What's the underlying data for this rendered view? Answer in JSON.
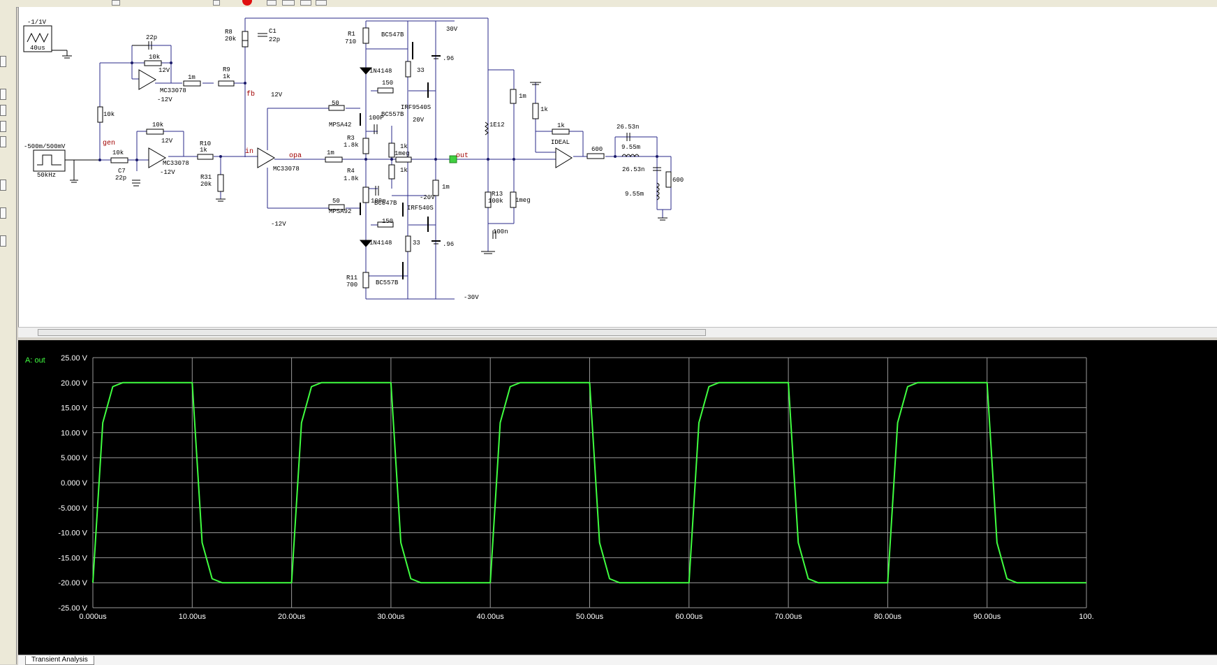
{
  "schematic": {
    "source1": {
      "label": "-1/1V",
      "period": "40us"
    },
    "source2": {
      "label": "-500m/500mV",
      "freq": "50kHz"
    },
    "components": {
      "c_22p_top": "22p",
      "r_10k_fb1": "10k",
      "r_1m_a": "1m",
      "r9_name": "R9",
      "r9_val": "1k",
      "r8_name": "R8",
      "r8_val": "20k",
      "c1_name": "C1",
      "c1_val": "22p",
      "r1_name": "R1",
      "r1_val": "710",
      "q_bc547b_top": "BC547B",
      "v_30": "30V",
      "batt_top": ".96",
      "d_top": "1N4148",
      "r_150_top": "150",
      "r_33_top": "33",
      "q_irf9540s": "IRF9540S",
      "r_50_top": "50",
      "q_mpsa42": "MPSA42",
      "c_100p_top": "100P",
      "q_bc557b_mid": "BC557B",
      "v_20": "20V",
      "r3_name": "R3",
      "r3_val": "1.8k",
      "r_1k_a": "1k",
      "r_1meg": "1meg",
      "r_1k_b": "1k",
      "r4_name": "R4",
      "r4_val": "1.8k",
      "c_100p_bot": "100p",
      "v_m20": "-20V",
      "r_1m_out": "1m",
      "r_50_bot": "50",
      "q_mpsa92": "MPSA92",
      "q_bc547b_bot": "BC547B",
      "q_irf540s": "IRF540S",
      "r_150_bot": "150",
      "d_bot": "1N4148",
      "r_33_bot": "33",
      "batt_bot": ".96",
      "r11_name": "R11",
      "r11_val": "700",
      "q_bc557b_bot": "BC557B",
      "v_m30": "-30V",
      "r_10k_left": "10k",
      "r_10k_fb2": "10k",
      "r_10k_in": "10k",
      "c7_name": "C7",
      "c7_val": "22p",
      "r10_name": "R10",
      "r10_val": "1k",
      "r31_name": "R31",
      "r31_val": "20k",
      "opamp1": "MC33078",
      "opamp2": "MC33078",
      "opamp3": "MC33078",
      "v_12_a": "12V",
      "v_m12_a": "-12V",
      "v_12_b": "12V",
      "v_m12_b": "-12V",
      "v_12_c": "12V",
      "v_m12_c": "-12V",
      "r_1m_opa": "1m",
      "r_1e12": "1E12",
      "r_1m_right": "1m",
      "r13_name": "R13",
      "r13_val": "100k",
      "r_1meg_right": "1meg",
      "c_100n": "100n",
      "r_1k_right1": "1k",
      "r_1k_right2": "1k",
      "ideal": "IDEAL",
      "r_600_a": "600",
      "c_26_53n_a": "26.53n",
      "l_9_55m_a": "9.55m",
      "c_26_53n_b": "26.53n",
      "l_9_55m_b": "9.55m",
      "r_600_b": "600"
    },
    "nets": {
      "gen": "gen",
      "fb": "fb",
      "in": "in",
      "opa": "opa",
      "out": "out",
      "probe": "A"
    }
  },
  "scope": {
    "trace_label": "A: out",
    "trace_color": "#40ff40",
    "grid_color": "#9a9a9a"
  },
  "tabs": [
    "Transient Analysis"
  ],
  "chart_data": {
    "type": "line",
    "series": [
      {
        "name": "A: out",
        "x": [
          0,
          1,
          2,
          3,
          10,
          11,
          12,
          13,
          20,
          21,
          22,
          23,
          30,
          31,
          32,
          33,
          40,
          41,
          42,
          43,
          50,
          51,
          52,
          53,
          60,
          61,
          62,
          63,
          70,
          71,
          72,
          73,
          80,
          81,
          82,
          83,
          90,
          91,
          92,
          93,
          100
        ],
        "values": [
          -20,
          12,
          19.2,
          20,
          20,
          -12,
          -19.2,
          -20,
          -20,
          12,
          19.2,
          20,
          20,
          -12,
          -19.2,
          -20,
          -20,
          12,
          19.2,
          20,
          20,
          -12,
          -19.2,
          -20,
          -20,
          12,
          19.2,
          20,
          20,
          -12,
          -19.2,
          -20,
          -20,
          12,
          19.2,
          20,
          20,
          -12,
          -19.2,
          -20,
          -20
        ]
      }
    ],
    "y_ticks": [
      "25.00 V",
      "20.00 V",
      "15.00 V",
      "10.00 V",
      "5.000 V",
      "0.000 V",
      "-5.000 V",
      "-10.00 V",
      "-15.00 V",
      "-20.00 V",
      "-25.00 V"
    ],
    "x_ticks": [
      "0.000us",
      "10.00us",
      "20.00us",
      "30.00us",
      "40.00us",
      "50.00us",
      "60.00us",
      "70.00us",
      "80.00us",
      "90.00us",
      "100."
    ],
    "xlim": [
      0,
      100
    ],
    "ylim": [
      -25,
      25
    ],
    "grid": true
  }
}
